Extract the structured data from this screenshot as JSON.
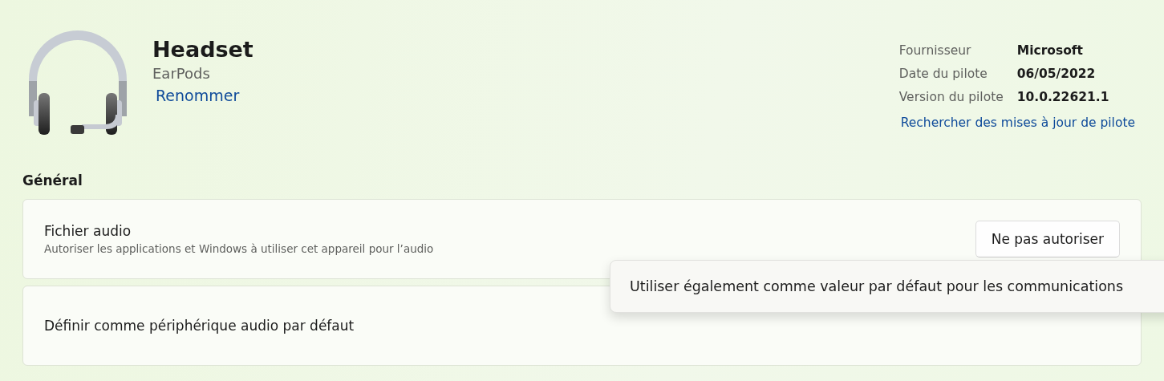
{
  "device": {
    "name": "Headset",
    "model": "EarPods",
    "rename_link": "Renommer"
  },
  "driver_info": {
    "rows": [
      {
        "label": "Fournisseur",
        "value": "Microsoft"
      },
      {
        "label": "Date du pilote",
        "value": "06/05/2022"
      },
      {
        "label": "Version du pilote",
        "value": "10.0.22621.1"
      }
    ],
    "update_link": "Rechercher des mises à jour de pilote"
  },
  "section_title": "Général",
  "settings": [
    {
      "title": "Fichier audio",
      "description": "Autoriser les applications et Windows à utiliser cet appareil pour l’audio",
      "button": "Ne pas autoriser"
    },
    {
      "title": "Définir comme périphérique audio par défaut"
    }
  ],
  "menu": {
    "items": [
      "Utiliser également comme valeur par défaut pour les communications"
    ]
  }
}
